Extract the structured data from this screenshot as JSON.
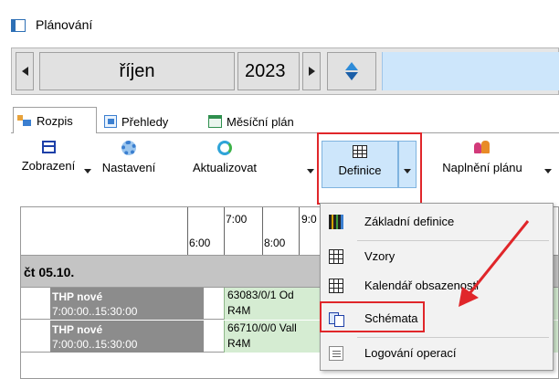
{
  "window": {
    "title": "Plánování"
  },
  "nav": {
    "month": "říjen",
    "year": "2023"
  },
  "tabs": [
    {
      "label": "Rozpis",
      "active": true
    },
    {
      "label": "Přehledy",
      "active": false
    },
    {
      "label": "Měsíční plán",
      "active": false
    }
  ],
  "ribbon": {
    "zobrazeni": "Zobrazení",
    "nastaveni": "Nastavení",
    "aktualizovat": "Aktualizovat",
    "definice": "Definice",
    "naplneni": "Naplnění plánu"
  },
  "grid": {
    "times_top": [
      "7:00",
      "9:0"
    ],
    "times_bottom": [
      "6:00",
      "8:00"
    ],
    "day_label": "čt 05.10.",
    "rows": [
      {
        "shift": "THP nové",
        "time": "7:00:00..15:30:00",
        "task": "63083/0/1 Od",
        "code": "R4M"
      },
      {
        "shift": "THP nové",
        "time": "7:00:00..15:30:00",
        "task": "66710/0/0 Vall",
        "code": "R4M"
      }
    ]
  },
  "menu": {
    "items": [
      {
        "label": "Základní definice",
        "icon": "basic-definition-icon"
      },
      {
        "label": "Vzory",
        "icon": "grid-icon"
      },
      {
        "label": "Kalendář obsazenosti",
        "icon": "grid-icon"
      },
      {
        "label": "Schémata",
        "icon": "copy-icon"
      },
      {
        "label": "Logování operací",
        "icon": "log-icon"
      }
    ]
  },
  "colors": {
    "accent": "#cde6fb",
    "highlight_red": "#e0262a",
    "task_green": "#d5ecd2",
    "shift_gray": "#8c8c8c",
    "day_gray": "#c4c4c4"
  }
}
